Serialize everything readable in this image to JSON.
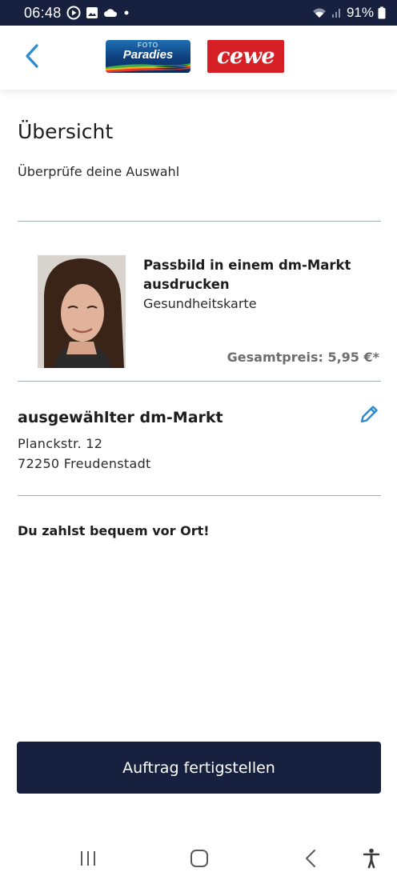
{
  "status_bar": {
    "time": "06:48",
    "battery_percent": "91%",
    "left_icons": [
      "play-circle-icon",
      "image-icon",
      "cloud-icon",
      "dot-icon"
    ],
    "right_icons": [
      "wifi-icon",
      "signal-icon",
      "battery-icon"
    ]
  },
  "header": {
    "back_icon": "chevron-left-icon",
    "logo_fotoparadies": {
      "top_text": "FOTO",
      "main_text": "Paradies"
    },
    "logo_cewe": {
      "text": "cewe"
    },
    "colors": {
      "cewe_red": "#d71f26",
      "accent_blue": "#2a8bd0"
    }
  },
  "overview": {
    "title": "Übersicht",
    "subtitle": "Überprüfe deine Auswahl"
  },
  "product": {
    "name": "Passbild in einem dm-Markt ausdrucken",
    "variant": "Gesundheitskarte",
    "total_price": "Gesamtpreis: 5,95 €*"
  },
  "store": {
    "heading": "ausgewählter dm-Markt",
    "street": "Planckstr. 12",
    "city": "72250 Freudenstadt",
    "edit_icon": "pencil-icon"
  },
  "payment": {
    "note": "Du zahlst bequem vor Ort!"
  },
  "actions": {
    "submit_label": "Auftrag fertigstellen",
    "primary_color": "#17213f"
  },
  "nav_bar": {
    "icons": [
      "recent-apps-icon",
      "home-icon",
      "back-icon",
      "accessibility-icon"
    ]
  }
}
